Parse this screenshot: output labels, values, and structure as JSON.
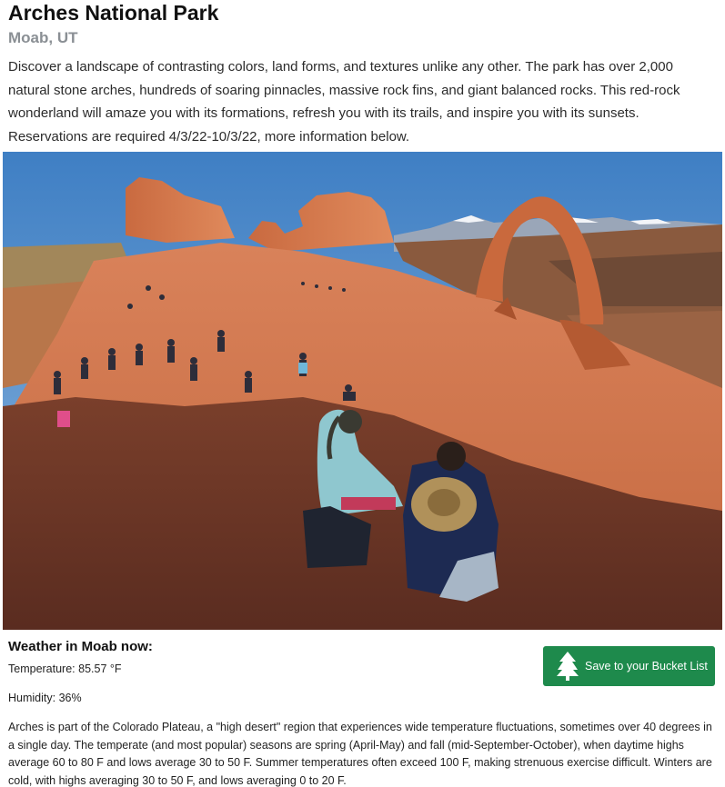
{
  "park": {
    "name": "Arches National Park",
    "location": "Moab, UT",
    "description": "Discover a landscape of contrasting colors, land forms, and textures unlike any other. The park has over 2,000 natural stone arches, hundreds of soaring pinnacles, massive rock fins, and giant balanced rocks. This red-rock wonderland will amaze you with its formations, refresh you with its trails, and inspire you with its sunsets. Reservations are required 4/3/22-10/3/22, more information below."
  },
  "hero_image": {
    "icon": "photo-delicate-arch"
  },
  "weather": {
    "heading": "Weather in Moab now:",
    "temperature": "Temperature: 85.57 °F",
    "humidity": "Humidity: 36%"
  },
  "bucket_button": {
    "label": "Save to your Bucket List",
    "icon": "tree-icon",
    "color": "#1e8a4c"
  },
  "climate": {
    "text": "Arches is part of the Colorado Plateau, a \"high desert\" region that experiences wide temperature fluctuations, sometimes over 40 degrees in a single day. The temperate (and most popular) seasons are spring (April-May) and fall (mid-September-October), when daytime highs average 60 to 80 F and lows average 30 to 50 F. Summer temperatures often exceed 100 F, making strenuous exercise difficult. Winters are cold, with highs averaging 30 to 50 F, and lows averaging 0 to 20 F."
  }
}
